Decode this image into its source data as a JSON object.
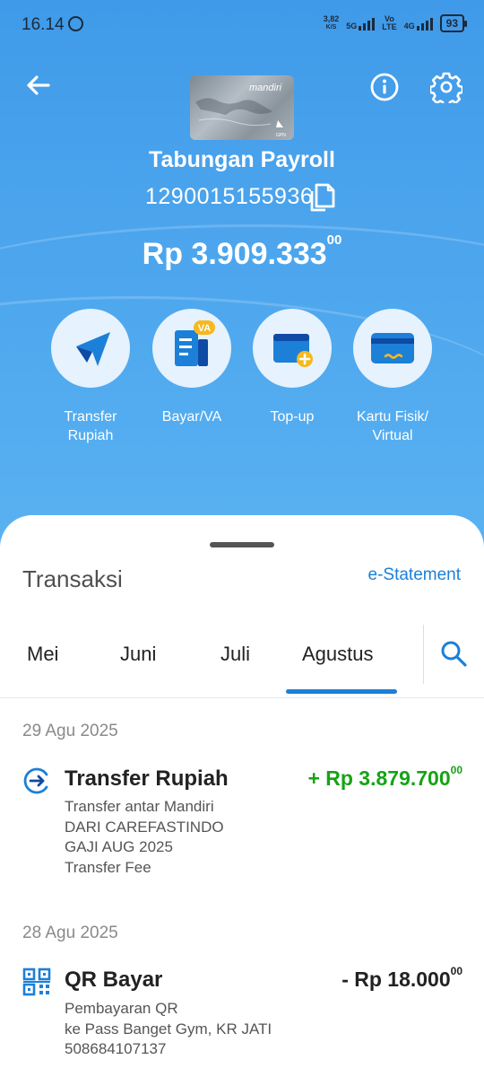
{
  "status": {
    "time": "16.14",
    "net_speed": "3,82",
    "net_unit": "K/S",
    "sig1_label": "5G",
    "volte_top": "Vo",
    "volte_bottom": "LTE",
    "sig2_label": "4G",
    "battery": "93"
  },
  "account": {
    "name": "Tabungan Payroll",
    "number": "1290015155936",
    "balance": "Rp 3.909.333",
    "balance_cents": "00",
    "card_brand": "mandiri"
  },
  "actions": [
    {
      "label": "Transfer\nRupiah",
      "icon": "paper-plane-icon"
    },
    {
      "label": "Bayar/VA",
      "icon": "bill-va-icon",
      "badge": "VA"
    },
    {
      "label": "Top-up",
      "icon": "wallet-plus-icon"
    },
    {
      "label": "Kartu Fisik/\nVirtual",
      "icon": "card-icon"
    }
  ],
  "transactions_section": {
    "title": "Transaksi",
    "estatement": "e-Statement"
  },
  "tabs": [
    "Mei",
    "Juni",
    "Juli",
    "Agustus"
  ],
  "active_tab": "Agustus",
  "groups": [
    {
      "date": "29 Agu 2025",
      "items": [
        {
          "icon": "transfer-circle-icon",
          "title": "Transfer Rupiah",
          "amount": "+ Rp 3.879.700",
          "cents": "00",
          "direction": "credit",
          "desc": [
            "Transfer antar Mandiri",
            "DARI CAREFASTINDO",
            "GAJI AUG 2025",
            "Transfer Fee"
          ]
        }
      ]
    },
    {
      "date": "28 Agu 2025",
      "items": [
        {
          "icon": "qr-code-icon",
          "title": "QR Bayar",
          "amount": "- Rp 18.000",
          "cents": "00",
          "direction": "debit",
          "desc": [
            "Pembayaran QR",
            "ke Pass Banget Gym, KR JATI",
            "508684107137"
          ]
        }
      ]
    }
  ],
  "colors": {
    "primary": "#1c80d8",
    "credit": "#16a316",
    "debit": "#222222",
    "hero": "#4aa3ec"
  }
}
